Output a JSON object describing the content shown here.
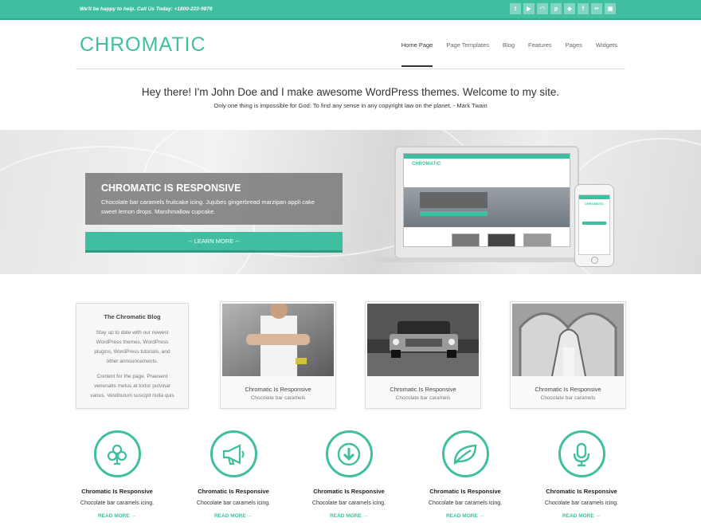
{
  "topbar": {
    "tagline": "We'll be happy to help. Call Us Today: +1800-222-9876",
    "social_icons": [
      "twitter-icon",
      "youtube-icon",
      "rss-icon",
      "pinterest-icon",
      "dropbox-icon",
      "facebook-icon",
      "flickr-icon",
      "android-icon"
    ]
  },
  "header": {
    "logo": "CHROMATIC",
    "nav": [
      "Home Page",
      "Page Templates",
      "Blog",
      "Features",
      "Pages",
      "Widgets"
    ]
  },
  "intro": {
    "heading": "Hey there! I'm John Doe and I make awesome WordPress themes. Welcome to my site.",
    "quote": "Only one thing is impossible for God: To find any sense in any copyright law on the planet. - Mark Twain"
  },
  "hero": {
    "title": "CHROMATIC IS RESPONSIVE",
    "text": "Chocolate bar caramels fruitcake icing. Jujubes gingerbread marzipan appli cake sweet lemon drops. Marshmallow cupcake.",
    "button": "-- LEARN MORE --",
    "device_logo": "CHROMATIC"
  },
  "blog_box": {
    "title": "The Chromatic Blog",
    "p1": "Stay up to date with our newest WordPress themes, WordPress plugins, WordPress tutorials, and other announcements.",
    "p2": "Content for the page. Praesent venenatis metus at tortor pulvinar varius. Vestibulum suscipit nulla quis"
  },
  "cards": [
    {
      "title": "Chromatic Is Responsive",
      "subtitle": "Chocolate bar caramels"
    },
    {
      "title": "Chromatic Is Responsive",
      "subtitle": "Chocolate bar caramels"
    },
    {
      "title": "Chromatic Is Responsive",
      "subtitle": "Chocolate bar caramels"
    }
  ],
  "features": [
    {
      "icon": "club-icon",
      "title": "Chromatic Is Responsive",
      "text": "Chocolate bar caramels icing.",
      "link": "READ MORE →"
    },
    {
      "icon": "megaphone-icon",
      "title": "Chromatic Is Responsive",
      "text": "Chocolate bar caramels icing.",
      "link": "READ MORE →"
    },
    {
      "icon": "download-icon",
      "title": "Chromatic Is Responsive",
      "text": "Chocolate bar caramels icing.",
      "link": "READ MORE →"
    },
    {
      "icon": "leaf-icon",
      "title": "Chromatic Is Responsive",
      "text": "Chocolate bar caramels icing.",
      "link": "READ MORE →"
    },
    {
      "icon": "microphone-icon",
      "title": "Chromatic Is Responsive",
      "text": "Chocolate bar caramels icing.",
      "link": "READ MORE →"
    }
  ],
  "colors": {
    "accent": "#3fbfa0",
    "accent_dark": "#2f9c82",
    "text": "#333333"
  }
}
